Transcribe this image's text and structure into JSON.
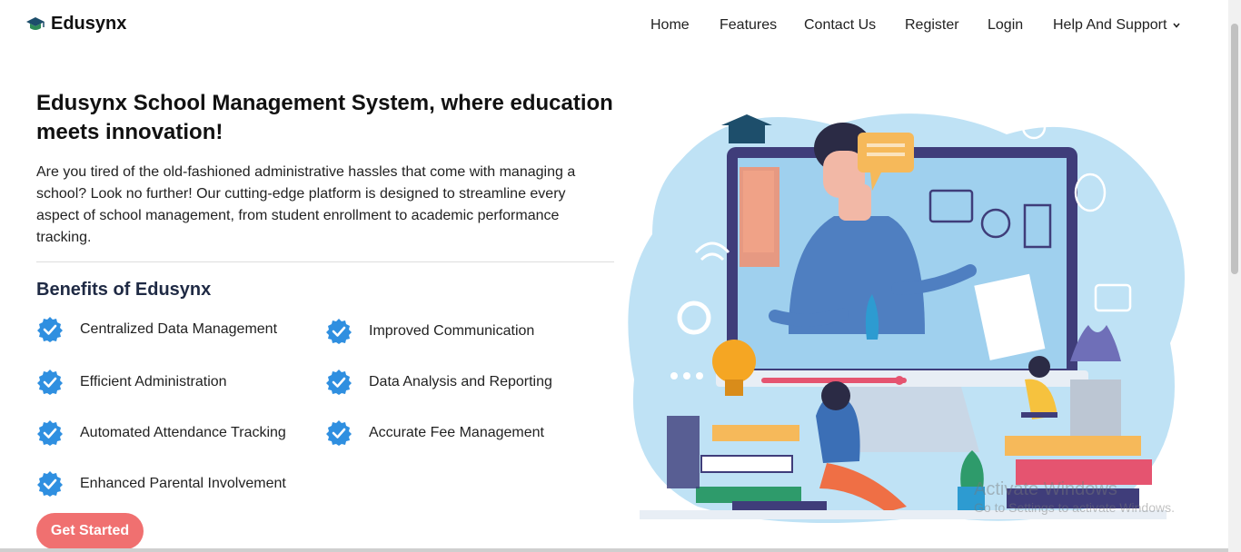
{
  "brand": {
    "name": "Edusynx",
    "icon": "graduation-cap-icon"
  },
  "nav": {
    "home": "Home",
    "features": "Features",
    "contact": "Contact Us",
    "register": "Register",
    "login": "Login",
    "help": "Help And Support",
    "help_icon": "chevron-down-icon"
  },
  "hero": {
    "title": "Edusynx School Management System, where education meets innovation!",
    "intro": "Are you tired of the old-fashioned administrative hassles that come with managing a school? Look no further! Our cutting-edge platform is designed to streamline every aspect of school management, from student enrollment to academic performance tracking."
  },
  "benefits": {
    "title": "Benefits of Edusynx",
    "items": [
      "Centralized Data Management",
      "Improved Communication",
      "Efficient Administration",
      "Data Analysis and Reporting",
      "Automated Attendance Tracking",
      "Accurate Fee Management",
      "Enhanced Parental Involvement"
    ]
  },
  "cta": {
    "label": "Get Started"
  },
  "watermark": {
    "title": "Activate Windows",
    "subtitle": "Go to Settings to activate Windows."
  },
  "colors": {
    "accent": "#f07070",
    "check": "#2f8fe0",
    "illustration_bg": "#bfe2f5"
  }
}
